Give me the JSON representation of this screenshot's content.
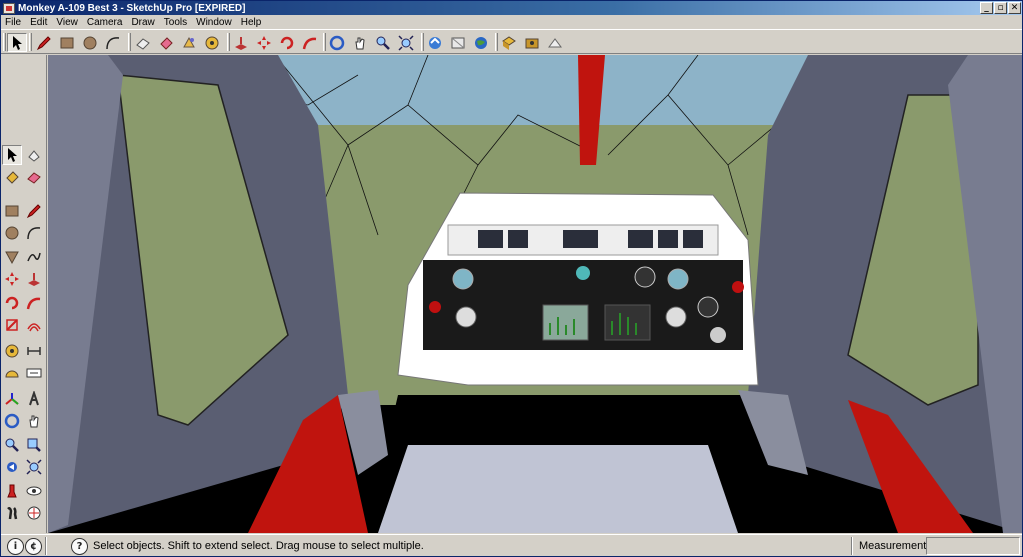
{
  "window": {
    "title": "Monkey A-109 Best 3 - SketchUp Pro [EXPIRED]",
    "controls": {
      "minimize": "_",
      "maximize": "▫",
      "close": "✕"
    }
  },
  "menu": {
    "items": [
      "File",
      "Edit",
      "View",
      "Camera",
      "Draw",
      "Tools",
      "Window",
      "Help"
    ]
  },
  "toolbar": {
    "icons": [
      "select-icon",
      "pencil-icon",
      "rectangle-icon",
      "circle-icon",
      "arc-icon",
      "eraser-icon",
      "paint-bucket-icon",
      "make-component-icon",
      "tape-measure-icon",
      "push-pull-icon",
      "move-icon",
      "rotate-icon",
      "follow-me-icon",
      "orbit-icon",
      "pan-icon",
      "zoom-icon",
      "zoom-extents-icon",
      "get-models-icon",
      "share-model-icon",
      "google-earth-icon",
      "components-icon",
      "get-photo-icon",
      "toggle-terrain-icon"
    ]
  },
  "palette": {
    "icons": [
      "select-icon",
      "make-component-icon",
      "paint-bucket-icon",
      "eraser-icon",
      "rectangle-icon",
      "line-icon",
      "circle-icon",
      "arc-icon",
      "polygon-icon",
      "freehand-icon",
      "move-icon",
      "push-pull-icon",
      "rotate-icon",
      "follow-me-icon",
      "scale-icon",
      "offset-icon",
      "tape-measure-icon",
      "dimension-icon",
      "protractor-icon",
      "text-icon",
      "axes-icon",
      "3d-text-icon",
      "orbit-icon",
      "pan-icon",
      "zoom-icon",
      "zoom-window-icon",
      "previous-view-icon",
      "zoom-extents-icon",
      "position-camera-icon",
      "look-around-icon",
      "walk-icon",
      "section-plane-icon"
    ]
  },
  "colors": {
    "sky": "#8db3c8",
    "ground": "#8a9a6c",
    "interior_grey": "#c0c4d4",
    "dark_panel": "#5a5e72",
    "accent_red": "#c0140e",
    "dash_white": "#ffffff",
    "panel_black": "#1a1a1a"
  },
  "status": {
    "text": "Select objects. Shift to extend select. Drag mouse to select multiple.",
    "measurements_label": "Measurements",
    "measurements_value": ""
  }
}
